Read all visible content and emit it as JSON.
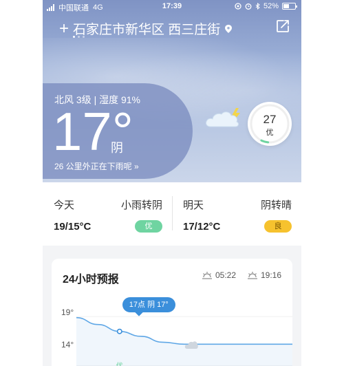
{
  "status_bar": {
    "carrier": "中国联通",
    "network": "4G",
    "time": "17:39",
    "battery": "52%",
    "battery_level": 0.52
  },
  "header": {
    "location": "石家庄市新华区 西三庄街",
    "page_count": 3,
    "active_page": 0
  },
  "current": {
    "wind_humidity": "北风 3级 | 湿度 91%",
    "temperature": "17°",
    "condition": "阴",
    "rain_message": "26 公里外正在下雨呢 »"
  },
  "aqi": {
    "value": "27",
    "label": "优",
    "level_fraction": 0.06
  },
  "forecast": {
    "today": {
      "label": "今天",
      "condition": "小雨转阴",
      "temp": "19/15°C",
      "aqi": "优"
    },
    "tomorrow": {
      "label": "明天",
      "condition": "阴转晴",
      "temp": "17/12°C",
      "aqi": "良"
    }
  },
  "hourly": {
    "title": "24小时预报",
    "sunrise": "05:22",
    "sunset": "19:16",
    "tooltip": "17点 阴 17°",
    "aqi_label": "优"
  },
  "chart_data": {
    "type": "line",
    "y_ticks": [
      "19°",
      "14°"
    ],
    "series": [
      {
        "values": [
          18.9,
          18.2,
          17.5,
          17.0,
          16.4,
          16.2,
          16.2,
          16.2,
          16.2,
          16.2,
          16.2
        ]
      }
    ],
    "highlight_index": 2,
    "ylim": [
      13,
      20
    ]
  },
  "colors": {
    "accent": "#3b8fdb",
    "good": "#6fd4a1",
    "moderate": "#f6c22e"
  }
}
